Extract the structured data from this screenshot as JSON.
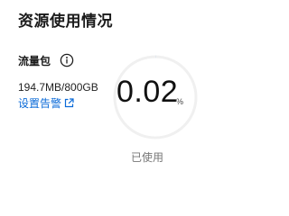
{
  "section": {
    "title": "资源使用情况"
  },
  "traffic_package": {
    "label": "流量包",
    "info_icon": "info-circle-icon",
    "usage": "194.7MB/800GB",
    "alarm_link": "设置告警",
    "alarm_link_icon": "external-link-icon",
    "usage_percent": 0.02,
    "usage_percent_text": "0.02",
    "unit": "%",
    "used_label": "已使用"
  },
  "colors": {
    "link": "#0a6ad8",
    "ring_track": "#f0f0f0",
    "muted_text": "#777777"
  }
}
